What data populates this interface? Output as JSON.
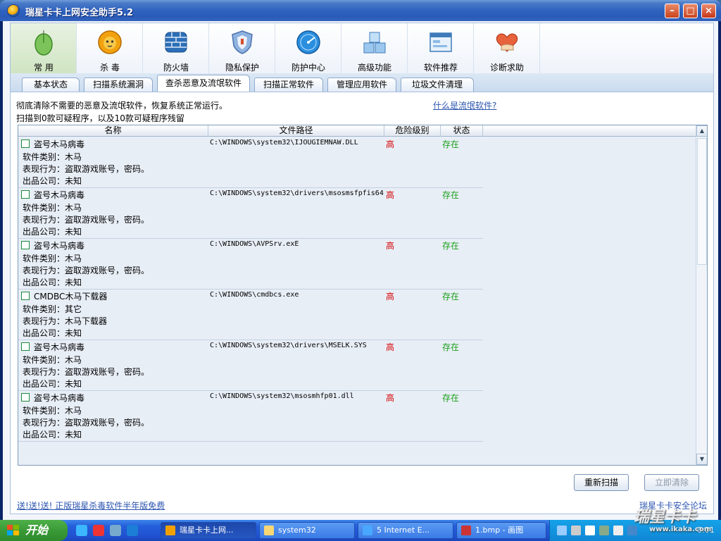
{
  "window": {
    "title": "瑞星卡卡上网安全助手5.2"
  },
  "toolbar": [
    {
      "label": "常 用",
      "icon": "mouse-icon"
    },
    {
      "label": "杀 毒",
      "icon": "lion-icon"
    },
    {
      "label": "防火墙",
      "icon": "firewall-icon"
    },
    {
      "label": "隐私保护",
      "icon": "shield-icon"
    },
    {
      "label": "防护中心",
      "icon": "globe-icon"
    },
    {
      "label": "高级功能",
      "icon": "cubes-icon"
    },
    {
      "label": "软件推荐",
      "icon": "window-icon"
    },
    {
      "label": "诊断求助",
      "icon": "heart-hand-icon"
    }
  ],
  "tabs": [
    {
      "label": "基本状态"
    },
    {
      "label": "扫描系统漏洞"
    },
    {
      "label": "查杀恶意及流氓软件"
    },
    {
      "label": "扫描正常软件"
    },
    {
      "label": "管理应用软件"
    },
    {
      "label": "垃圾文件清理"
    }
  ],
  "panel": {
    "desc_line1": "彻底清除不需要的恶意及流氓软件，恢复系统正常运行。",
    "desc_line2": "扫描到0款可疑程序，以及10款可疑程序残留",
    "what_link": "什么是流氓软件?"
  },
  "list": {
    "headers": {
      "name": "名称",
      "path": "文件路径",
      "level": "危险级别",
      "status": "状态"
    },
    "rows": [
      {
        "name": "盗号木马病毒",
        "path": "C:\\WINDOWS\\system32\\IJOUGIEMNAW.DLL",
        "level": "高",
        "status": "存在",
        "d1": "软件类别：木马",
        "d2": "表现行为：盗取游戏账号，密码。",
        "d3": "出品公司：未知"
      },
      {
        "name": "盗号木马病毒",
        "path": "C:\\WINDOWS\\system32\\drivers\\msosmsfpfis64",
        "level": "高",
        "status": "存在",
        "d1": "软件类别：木马",
        "d2": "表现行为：盗取游戏账号，密码。",
        "d3": "出品公司：未知"
      },
      {
        "name": "盗号木马病毒",
        "path": "C:\\WINDOWS\\AVPSrv.exE",
        "level": "高",
        "status": "存在",
        "d1": "软件类别：木马",
        "d2": "表现行为：盗取游戏账号，密码。",
        "d3": "出品公司：未知"
      },
      {
        "name": "CMDBC木马下载器",
        "path": "C:\\WINDOWS\\cmdbcs.exe",
        "level": "高",
        "status": "存在",
        "d1": "软件类别：其它",
        "d2": "表现行为：木马下载器",
        "d3": "出品公司：未知"
      },
      {
        "name": "盗号木马病毒",
        "path": "C:\\WINDOWS\\system32\\drivers\\MSELK.SYS",
        "level": "高",
        "status": "存在",
        "d1": "软件类别：木马",
        "d2": "表现行为：盗取游戏账号，密码。",
        "d3": "出品公司：未知"
      },
      {
        "name": "盗号木马病毒",
        "path": "C:\\WINDOWS\\system32\\msosmhfp01.dll",
        "level": "高",
        "status": "存在",
        "d1": "软件类别：木马",
        "d2": "表现行为：盗取游戏账号，密码。",
        "d3": "出品公司：未知"
      }
    ]
  },
  "buttons": {
    "rescan": "重新扫描",
    "clear": "立即清除"
  },
  "footer": {
    "promo": "送!送!送! 正版瑞星杀毒软件半年版免费",
    "forum": "瑞星卡卡安全论坛"
  },
  "taskbar": {
    "start": "开始",
    "tasks": [
      {
        "label": "瑞星卡卡上网..."
      },
      {
        "label": "system32"
      },
      {
        "label": "5 Internet E..."
      },
      {
        "label": "1.bmp - 画图"
      }
    ],
    "clock": "0:01"
  },
  "watermark": {
    "main": "瑞星卡卡",
    "sub": "www.ikaka.com"
  }
}
